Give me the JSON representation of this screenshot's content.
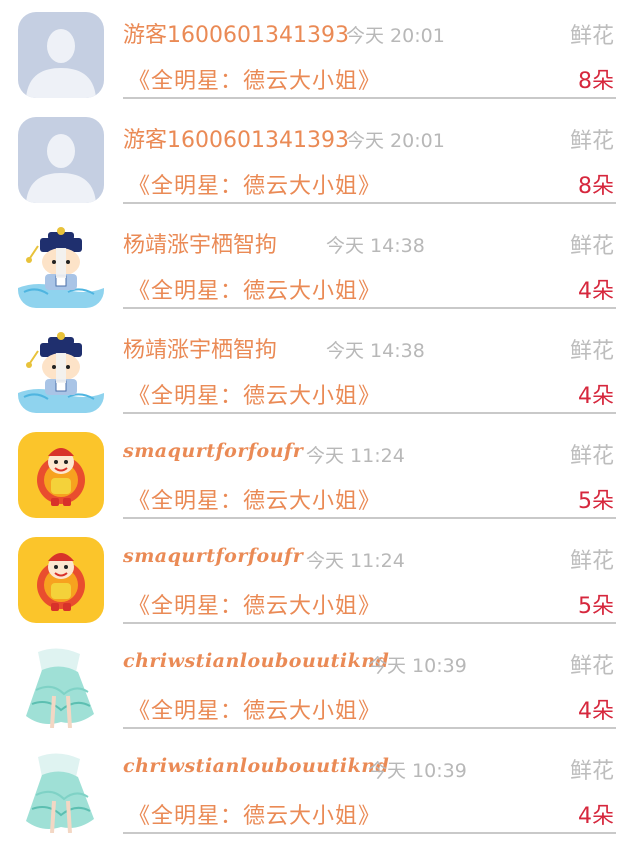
{
  "items": [
    {
      "username": "游客1600601341393",
      "time": "今天 20:01",
      "gift_type": "鲜花",
      "program": "《全明星：德云大小姐》",
      "count": "8朵",
      "avatar_icon": "default-user-avatar-icon"
    },
    {
      "username": "游客1600601341393",
      "time": "今天 20:01",
      "gift_type": "鲜花",
      "program": "《全明星：德云大小姐》",
      "count": "8朵",
      "avatar_icon": "default-user-avatar-icon"
    },
    {
      "username": "杨靖涨宇栖智拘",
      "time": "今天 14:38",
      "gift_type": "鲜花",
      "program": "《全明星：德云大小姐》",
      "count": "4朵",
      "avatar_icon": "cartoon-qing-official-avatar-icon"
    },
    {
      "username": "杨靖涨宇栖智拘",
      "time": "今天 14:38",
      "gift_type": "鲜花",
      "program": "《全明星：德云大小姐》",
      "count": "4朵",
      "avatar_icon": "cartoon-qing-official-avatar-icon"
    },
    {
      "username": "smaqurtforfoufr",
      "time": "今天 11:24",
      "gift_type": "鲜花",
      "program": "《全明星：德云大小姐》",
      "count": "5朵",
      "avatar_icon": "cartoon-clown-avatar-icon"
    },
    {
      "username": "smaqurtforfoufr",
      "time": "今天 11:24",
      "gift_type": "鲜花",
      "program": "《全明星：德云大小姐》",
      "count": "5朵",
      "avatar_icon": "cartoon-clown-avatar-icon"
    },
    {
      "username": "chriwstianloubouutiknd",
      "time": "今天 10:39",
      "gift_type": "鲜花",
      "program": "《全明星：德云大小姐》",
      "count": "4朵",
      "avatar_icon": "anime-dress-avatar-icon"
    },
    {
      "username": "chriwstianloubouutiknd",
      "time": "今天 10:39",
      "gift_type": "鲜花",
      "program": "《全明星：德云大小姐》",
      "count": "4朵",
      "avatar_icon": "anime-dress-avatar-icon"
    }
  ],
  "colors": {
    "username": "#ea8a55",
    "time": "#b8b8b8",
    "gift_type": "#bdbdbd",
    "count": "#d6273d",
    "divider": "#c9c9c9"
  }
}
